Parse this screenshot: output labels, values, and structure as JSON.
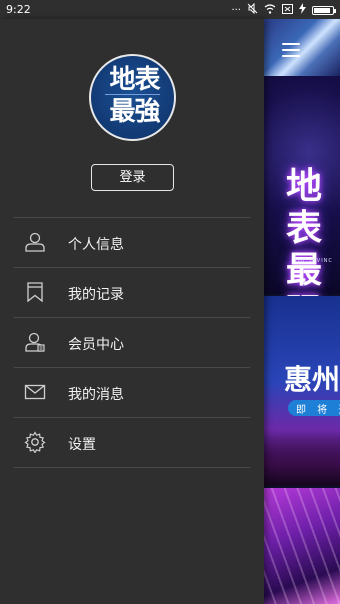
{
  "status_bar": {
    "time": "9:22",
    "more": "···",
    "icons": [
      "mute-icon",
      "wifi-icon",
      "sim-icon",
      "charging-icon",
      "battery-icon"
    ],
    "battery_level": 0.9
  },
  "drawer": {
    "avatar_text_line1": "地表",
    "avatar_text_line2": "最強",
    "login_label": "登录",
    "menu_items": [
      {
        "label": "个人信息",
        "icon": "person-icon"
      },
      {
        "label": "我的记录",
        "icon": "bookmark-icon"
      },
      {
        "label": "会员中心",
        "icon": "member-icon"
      },
      {
        "label": "我的消息",
        "icon": "mail-icon"
      },
      {
        "label": "设置",
        "icon": "gear-icon"
      }
    ]
  },
  "background_content": {
    "banner1_title": "地表\n最强",
    "banner1_subtitle": "THE INVINC",
    "banner2_city": "惠州",
    "banner2_ribbon": "即 将 开"
  },
  "colors": {
    "drawer_bg": "#2f2f2f",
    "divider": "#4a4a4a",
    "text": "#f2f2f2",
    "avatar_bg": "#123a74"
  }
}
